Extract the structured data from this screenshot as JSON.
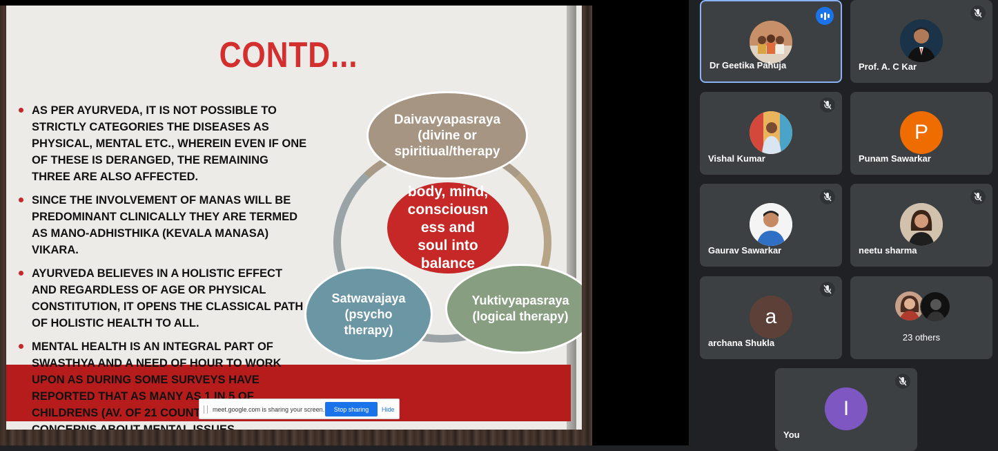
{
  "slide": {
    "title": "CONTD...",
    "bullets": [
      "As per Ayurveda, it is not possible to strictly categories the diseases as physical, mental etc., wherein even if one of these is deranged, the remaining three are also affected.",
      "Since the involvement of Manas will be predominant clinically they are termed as Mano-adhisthika (kevala manasa) vikara.",
      "Ayurveda believes in a holistic effect and regardless of age or physical constitution, it opens the classical path of holistic health to all.",
      "Mental health is an integral part of Swasthya and a need of hour to work upon as during some surveys have reported that as many as 1 in 5 of childrens (av. of 21 countries) have concerns about mental issues."
    ],
    "diagram": {
      "top": [
        "Daivavyapasraya",
        "(divine or",
        "spiritiual/therapy"
      ],
      "center": [
        "body, mind,",
        "consciousn",
        "ess and",
        "soul into",
        "balance"
      ],
      "left": [
        "Satwavajaya",
        "(psycho",
        "therapy)"
      ],
      "right": [
        "Yuktivyapasraya",
        "(logical therapy)"
      ]
    },
    "colors": {
      "title": "#d32f2f",
      "center": "#c62828",
      "top": "#a79583",
      "left": "#6b96a3",
      "right": "#879e80"
    }
  },
  "share_bar": {
    "message": "meet.google.com is sharing your screen.",
    "stop_label": "Stop sharing",
    "hide_label": "Hide"
  },
  "participants": [
    {
      "name": "Dr Geetika Pahuja",
      "avatar": "photo",
      "speaking": true
    },
    {
      "name": "Prof. A. C Kar",
      "avatar": "photo",
      "muted": true
    },
    {
      "name": "Vishal Kumar",
      "avatar": "photo",
      "muted": true
    },
    {
      "name": "Punam Sawarkar",
      "avatar": "letter",
      "letter": "P",
      "color": "#ef6c00"
    },
    {
      "name": "Gaurav Sawarkar",
      "avatar": "photo",
      "muted": true
    },
    {
      "name": "neetu sharma",
      "avatar": "photo",
      "muted": true
    },
    {
      "name": "archana Shukla",
      "avatar": "letter",
      "letter": "a",
      "color": "#5d4037",
      "muted": true
    },
    {
      "name": "23 others",
      "avatar": "group",
      "muted": true
    },
    {
      "name": "You",
      "avatar": "letter",
      "letter": "I",
      "color": "#7e57c2",
      "muted": true
    }
  ]
}
